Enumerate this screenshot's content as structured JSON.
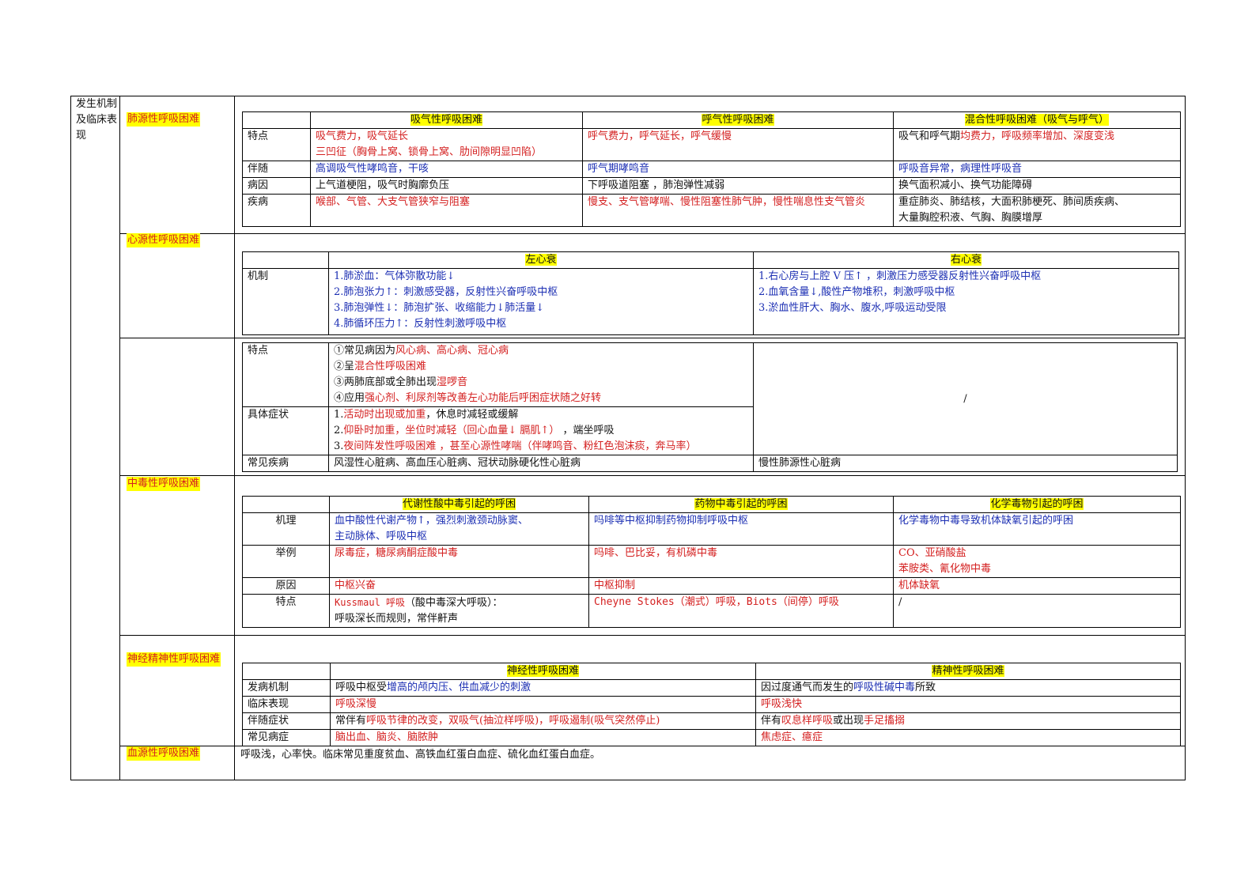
{
  "outer": {
    "label": "发生机制及临床表现"
  },
  "categories": {
    "lung": "肺源性呼吸困难",
    "heart": "心源性呼吸困难",
    "toxic": "中毒性呼吸困难",
    "neuro": "神经精神性呼吸困难",
    "blood": "血源性呼吸困难"
  },
  "lung": {
    "headers": [
      "吸气性呼吸困难",
      "呼气性呼吸困难",
      "混合性呼吸困难（吸气与呼气）"
    ],
    "rows": [
      {
        "label": "特点",
        "c1a": "吸气费力，吸气延长",
        "c1b": "三凹征（胸骨上窝、锁骨上窝、肋间隙明显凹陷）",
        "c2": "呼气费力，呼气延长，呼气缓慢",
        "c3_pre": "吸气和呼气期",
        "c3_red": "均费力，呼吸频率增加、深度变浅"
      },
      {
        "label": "伴随",
        "c1": "高调吸气性哮鸣音，干咳",
        "c2": "呼气期哮鸣音",
        "c3": "呼吸音异常，病理性呼吸音"
      },
      {
        "label": "病因",
        "c1": "上气道梗阻，吸气时胸廓负压",
        "c2": "下呼吸道阻塞 ，肺泡弹性减弱",
        "c3": "换气面积减小、换气功能障碍"
      },
      {
        "label": "疾病",
        "c1": "喉部、气管、大支气管狭窄与阻塞",
        "c2": "慢支、支气管哮喘、慢性阻塞性肺气肿，慢性喘息性支气管炎",
        "c3a": "重症肺炎、肺结核，大面积肺梗死、肺间质疾病、",
        "c3b": "大量胸腔积液、气胸、胸膜增厚"
      }
    ]
  },
  "heart": {
    "headers": [
      "左心衰",
      "右心衰"
    ],
    "mech_label": "机制",
    "left_mech": [
      "1.肺淤血：气体弥散功能↓",
      "2.肺泡张力↑：刺激感受器，反射性兴奋呼吸中枢",
      "3.肺泡弹性↓：肺泡扩张、收缩能力↓肺活量↓",
      "4.肺循环压力↑：反射性刺激呼吸中枢"
    ],
    "right_mech": [
      "1.右心房与上腔 V 压↑ ，刺激压力感受器反射性兴奋呼吸中枢",
      "2.血氧含量↓,酸性产物堆积，刺激呼吸中枢",
      "3.淤血性肝大、胸水、腹水,呼吸运动受限"
    ],
    "feature_label": "特点",
    "features": [
      {
        "pre": "①常见病因为",
        "red": "风心病、高心病、冠心病",
        "post": ""
      },
      {
        "pre": "②呈",
        "red": "混合性呼吸困难",
        "post": ""
      },
      {
        "pre": "③两肺底部或全肺出现",
        "red": "湿啰音",
        "post": ""
      },
      {
        "pre": "④应用",
        "red": "强心剂、利尿剂等改善左心功能后呼困症状随之好转",
        "post": ""
      }
    ],
    "symptom_label": "具体症状",
    "symptoms": [
      {
        "pre": "1.",
        "red": "活动时出现或加重",
        "post": "，休息时减轻或缓解"
      },
      {
        "pre": "2.",
        "red": "仰卧时加重，坐位时减轻（回心血量↓ 膈肌↑）",
        "post": " ，端坐呼吸"
      },
      {
        "pre": "3.",
        "red": "夜间阵发性呼吸困难 ，甚至心源性哮喘（伴哮鸣音、粉红色泡沫痰，奔马率）",
        "post": ""
      }
    ],
    "right_feature": "/",
    "disease_label": "常见疾病",
    "left_disease": "风湿性心脏病、高血压心脏病、冠状动脉硬化性心脏病",
    "right_disease": "慢性肺源性心脏病"
  },
  "toxic": {
    "headers": [
      "代谢性酸中毒引起的呼困",
      "药物中毒引起的呼困",
      "化学毒物引起的呼困"
    ],
    "rows": [
      {
        "label": "机理",
        "c1a": "血中酸性代谢产物↑，强烈刺激颈动脉窦、",
        "c1b": "主动脉体、呼吸中枢",
        "c2": "吗啡等中枢抑制药物抑制呼吸中枢",
        "c3": "化学毒物中毒导致机体缺氧引起的呼困"
      },
      {
        "label": "举例",
        "c1": "尿毒症，糖尿病酮症酸中毒",
        "c2": "吗啡、巴比妥，有机磷中毒",
        "c3a": "CO、亚硝酸盐",
        "c3b": "苯胺类、氰化物中毒"
      },
      {
        "label": "原因",
        "c1": "中枢兴奋",
        "c2": "中枢抑制",
        "c3": "机体缺氧"
      },
      {
        "label": "特点",
        "c1a_red": "Kussmaul 呼吸",
        "c1a_black": "（酸中毒深大呼吸）：",
        "c1b": "呼吸深长而规则，常伴鼾声",
        "c2": "Cheyne Stokes（潮式）呼吸，Biots（间停）呼吸",
        "c3": "/"
      }
    ]
  },
  "neuro": {
    "headers": [
      "神经性呼吸困难",
      "精神性呼吸困难"
    ],
    "rows": [
      {
        "label": "发病机制",
        "c1_pre": "呼吸中枢受",
        "c1_blue": "增高的颅内压、供血减少的刺激",
        "c2_pre": "因过度通气而发生的",
        "c2_blue": "呼吸性碱中毒",
        "c2_post": "所致"
      },
      {
        "label": "临床表现",
        "c1": "呼吸深慢",
        "c2": "呼吸浅快"
      },
      {
        "label": "伴随症状",
        "c1_pre": "常伴有",
        "c1_red": "呼吸节律的改变，双吸气(抽泣样呼吸)，呼吸遏制(吸气突然停止)",
        "c2_pre": "伴有",
        "c2_red": "叹息样呼吸",
        "c2_mid": "或出现",
        "c2_red2": "手足搐搦"
      },
      {
        "label": "常见病症",
        "c1": "脑出血、脑炎、脑脓肿",
        "c2": "焦虑症、癔症"
      }
    ]
  },
  "blood": {
    "text": "呼吸浅，心率快。临床常见重度贫血、高铁血红蛋白血症、硫化血红蛋白血症。"
  },
  "colors": {
    "red": "#d42020",
    "blue": "#1c2fb3",
    "highlight": "#ffff00"
  }
}
